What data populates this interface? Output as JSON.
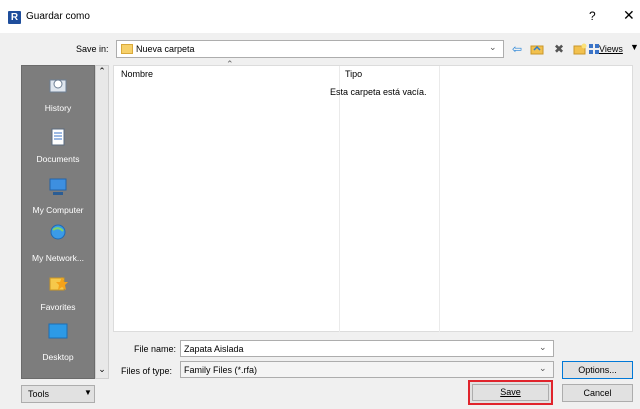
{
  "window": {
    "title": "Guardar como",
    "help": "?",
    "close": "✕",
    "app_icon_letter": "R"
  },
  "toolbar": {
    "save_in_label": "Save in:",
    "save_in_value": "Nueva carpeta",
    "views_label": "Views",
    "icons": [
      "back-icon",
      "up-folder-icon",
      "delete-icon",
      "new-folder-icon",
      "views-icon"
    ]
  },
  "places": [
    {
      "label": "History",
      "icon": "history-icon"
    },
    {
      "label": "Documents",
      "icon": "documents-icon"
    },
    {
      "label": "My Computer",
      "icon": "computer-icon"
    },
    {
      "label": "My Network...",
      "icon": "network-icon"
    },
    {
      "label": "Favorites",
      "icon": "favorites-icon"
    },
    {
      "label": "Desktop",
      "icon": "desktop-icon"
    }
  ],
  "filelist": {
    "columns": [
      "Nombre",
      "Tipo"
    ],
    "empty_message": "Esta carpeta está vacía."
  },
  "form": {
    "file_name_label": "File name:",
    "file_name_value": "Zapata Aislada",
    "file_type_label": "Files of type:",
    "file_type_value": "Family Files  (*.rfa)"
  },
  "buttons": {
    "tools": "Tools",
    "save": "Save",
    "cancel": "Cancel",
    "options": "Options..."
  },
  "colors": {
    "highlight": "#e0242c",
    "places_bg": "#7d7d7d"
  }
}
